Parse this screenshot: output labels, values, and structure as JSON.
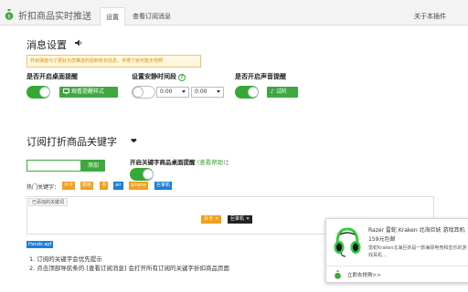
{
  "header": {
    "app_title": "折扣商品实时推送",
    "tabs": [
      {
        "label": "设置",
        "active": true
      },
      {
        "label": "查看订阅消息",
        "active": false
      }
    ],
    "about_label": "关于本插件"
  },
  "notify": {
    "section_title": "消息设置",
    "warning": "开启弹窗为了更好为您推送的拍到折扣信息，手慢了就可能无啦啊",
    "desktop_label": "是否开启桌面提醒",
    "desktop_on": true,
    "preview_button": "观看提醒样式",
    "quiet_label": "设置安静时间段",
    "quiet_on": false,
    "quiet_start": "0:00",
    "quiet_end": "0:00",
    "sound_label": "是否开启声音提醒",
    "sound_on": true,
    "test_button": "试听"
  },
  "keywords": {
    "section_title": "订阅打折商品关键字",
    "input_value": "",
    "add_button": "添加",
    "desktop_kw_label": "开启关键字商品桌面提醒",
    "help_link": "(查看帮助)",
    "desktop_kw_suffix": "：",
    "desktop_kw_on": true,
    "hot_label": "热门关键字：",
    "hot_tags": [
      {
        "label": "众卡",
        "color": "orange"
      },
      {
        "label": "鹊桥",
        "color": "orange"
      },
      {
        "label": "书",
        "color": "orange"
      },
      {
        "label": "air",
        "color": "blue"
      },
      {
        "label": "iphone",
        "color": "orange"
      },
      {
        "label": "巨掌机",
        "color": "blue"
      }
    ],
    "added_label": "已添加的关键词",
    "added_tags": [
      {
        "label": "众卡",
        "color": "orange"
      },
      {
        "label": "巨掌机",
        "color": "dark"
      }
    ],
    "extra_tag": "Hands apf",
    "notes": [
      "1. 订阅的关键字会优先提示",
      "2. 点击顶部导航条的 [查看订阅消息] 会打开所有订阅的关键字折扣商品页面"
    ]
  },
  "popup": {
    "title": "Razer 雷蛇 Kraken 北海巨妖 游戏耳机",
    "price": "159元包邮",
    "desc": "雷蛇Kraken北海巨妖是一款兼顾电竞和音乐的游戏耳机…",
    "link": "立即去抢购>>"
  },
  "colors": {
    "accent": "#3ea83e",
    "tag_orange": "#f0a020",
    "tag_blue": "#1b7fd6",
    "warning_text": "#e08a00"
  }
}
